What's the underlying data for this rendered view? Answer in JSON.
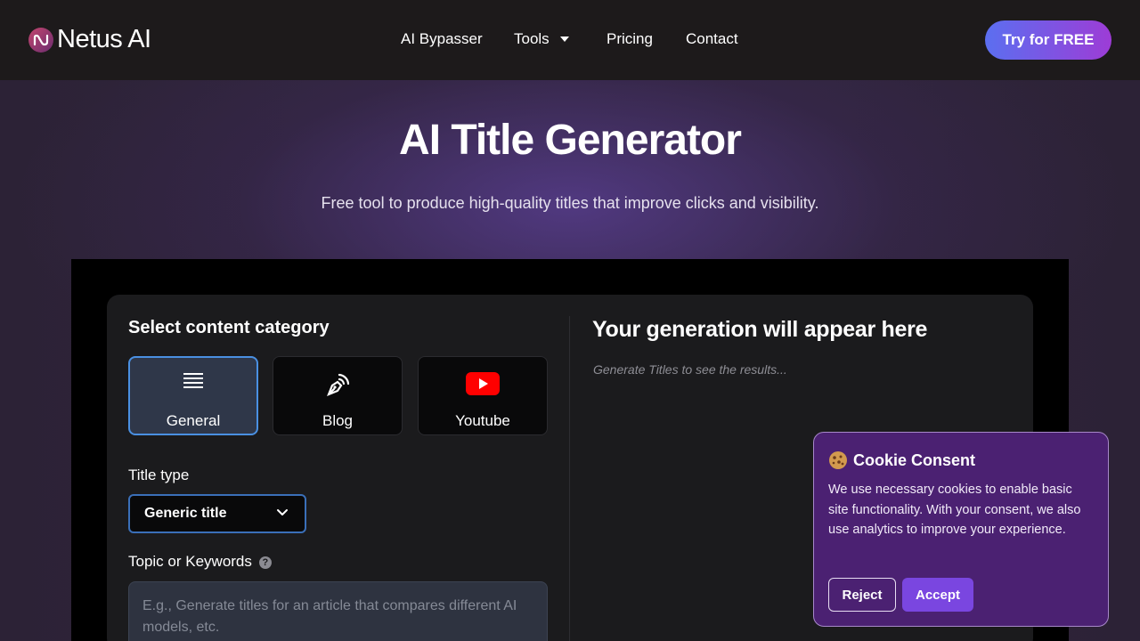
{
  "header": {
    "logo_text": "Netus AI",
    "nav": [
      {
        "label": "AI Bypasser"
      },
      {
        "label": "Tools"
      },
      {
        "label": "Pricing"
      },
      {
        "label": "Contact"
      }
    ],
    "cta_label": "Try for FREE"
  },
  "hero": {
    "title": "AI Title Generator",
    "subtitle": "Free tool to produce high-quality titles that improve clicks and visibility."
  },
  "form": {
    "category_heading": "Select content category",
    "categories": [
      {
        "label": "General",
        "icon": "list-icon",
        "active": true
      },
      {
        "label": "Blog",
        "icon": "pen-nib-icon",
        "active": false
      },
      {
        "label": "Youtube",
        "icon": "youtube-icon",
        "active": false
      }
    ],
    "title_type_label": "Title type",
    "title_type_value": "Generic title",
    "topic_label": "Topic or Keywords",
    "topic_placeholder": "E.g., Generate titles for an article that compares different AI models, etc."
  },
  "output": {
    "heading": "Your generation will appear here",
    "placeholder": "Generate Titles to see the results..."
  },
  "cookie": {
    "title": "Cookie Consent",
    "text": "We use necessary cookies to enable basic site functionality. With your consent, we also use analytics to improve your experience.",
    "reject_label": "Reject",
    "accept_label": "Accept"
  },
  "colors": {
    "accent_blue": "#4a90e2",
    "cta_gradient_start": "#5b6ff0",
    "cta_gradient_end": "#9d3cd6",
    "cookie_bg": "#4b2172",
    "accept_button": "#7a46e0",
    "youtube_red": "#ff0000"
  }
}
